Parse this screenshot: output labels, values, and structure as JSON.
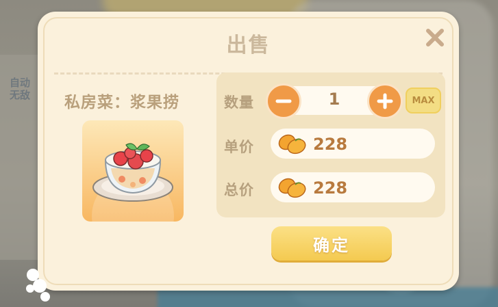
{
  "background": {
    "side_text": "自动无敌"
  },
  "dialog": {
    "title": "出售",
    "item_name": "私房菜：浆果捞",
    "item_icon": "berry-dessert-bowl-icon",
    "quantity_label": "数量",
    "quantity_value": "1",
    "max_label": "MAX",
    "unit_price_label": "单价",
    "unit_price_value": "228",
    "total_price_label": "总价",
    "total_price_value": "228",
    "confirm_label": "确定"
  },
  "colors": {
    "accent_orange": "#f09a47",
    "confirm_yellow": "#f4ca50",
    "dialog_bg": "#fbf1dc"
  }
}
